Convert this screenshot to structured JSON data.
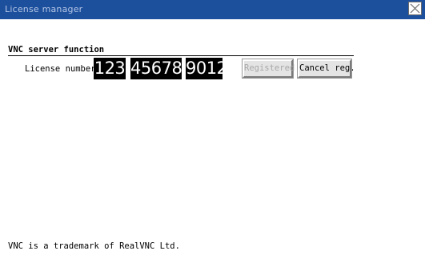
{
  "window": {
    "title": "License manager",
    "close_icon": "close-x-icon"
  },
  "vnc": {
    "section_title": "VNC server function",
    "license_label": "License number",
    "license_parts": [
      "123",
      "45678",
      "9012"
    ],
    "registered_label": "Registered",
    "cancel_label": "Cancel reg."
  },
  "footer": {
    "trademark_note": "VNC is a trademark of RealVNC Ltd."
  },
  "colors": {
    "titlebar": "#1c4f9c",
    "title_text": "#b4c6e6",
    "license_box_bg": "#000000",
    "license_box_text": "#ffffff",
    "disabled_text": "#a8a8a8"
  }
}
